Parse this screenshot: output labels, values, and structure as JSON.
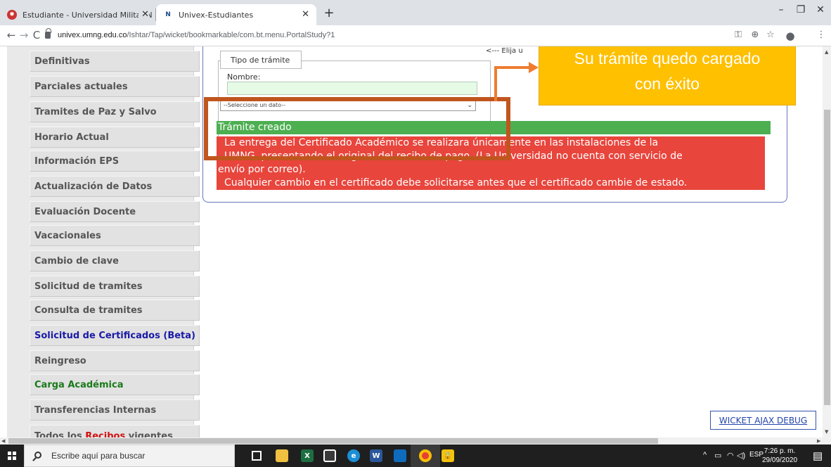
{
  "browser": {
    "tabs": [
      {
        "label": "Estudiante - Universidad Militar N",
        "active": false
      },
      {
        "label": "Univex-Estudiantes",
        "active": true
      }
    ],
    "new_tab_icon": "+",
    "url_host": "univex.umng.edu.co",
    "url_path": "/Ishtar/Tap/wicket/bookmarkable/com.bt.menu.PortalStudy?1"
  },
  "sidebar": {
    "items": [
      {
        "label": "Definitivas",
        "color": "#555555"
      },
      {
        "label": "Parciales actuales",
        "color": "#555555"
      },
      {
        "label": "Tramites de Paz y Salvo",
        "color": "#555555"
      },
      {
        "label": "Horario Actual",
        "color": "#555555"
      },
      {
        "label": "Información EPS",
        "color": "#555555"
      },
      {
        "label": "Actualización de Datos",
        "color": "#555555"
      },
      {
        "label": "Evaluación Docente",
        "color": "#555555"
      },
      {
        "label": "Vacacionales",
        "color": "#555555"
      },
      {
        "label": "Cambio de clave",
        "color": "#555555"
      },
      {
        "label": "Solicitud de tramites",
        "color": "#555555"
      },
      {
        "label": "Consulta de tramites",
        "color": "#555555"
      },
      {
        "label": "Solicitud de Certificados (Beta)",
        "color": "#1a1aa6"
      },
      {
        "label": "Reingreso",
        "color": "#555555"
      },
      {
        "label": "Carga Académica",
        "color": "#1a7a1a"
      },
      {
        "label": "Transferencias Internas",
        "color": "#555555"
      }
    ],
    "partial_item": {
      "prefix": "Todos los ",
      "highlight": "Recibos",
      "suffix": " vigentes"
    }
  },
  "form": {
    "legend": "Tipo de trámite",
    "nombre_label": "Nombre:",
    "nombre_value": "",
    "select_value": "--Seleccione un dato--",
    "hint": "<--- Elija u"
  },
  "status": {
    "created": "Trámite creado",
    "warning_lines": [
      "La entrega del Certificado Académico se realizara únicamente en las instalaciones de la",
      "UMNG, presentando el original del recibo de pago. (La Universidad no cuenta con servicio de",
      "envío por correo).",
      "Cualquier cambio en el certificado debe solicitarse antes que el certificado cambie de estado."
    ]
  },
  "callout": {
    "line1": "Su trámite quedo cargado",
    "line2": "con éxito"
  },
  "debug_link": "WICKET AJAX DEBUG",
  "taskbar": {
    "search_placeholder": "Escribe aquí para buscar",
    "language": "ESP",
    "time": "7:26 p. m.",
    "date": "29/09/2020"
  }
}
